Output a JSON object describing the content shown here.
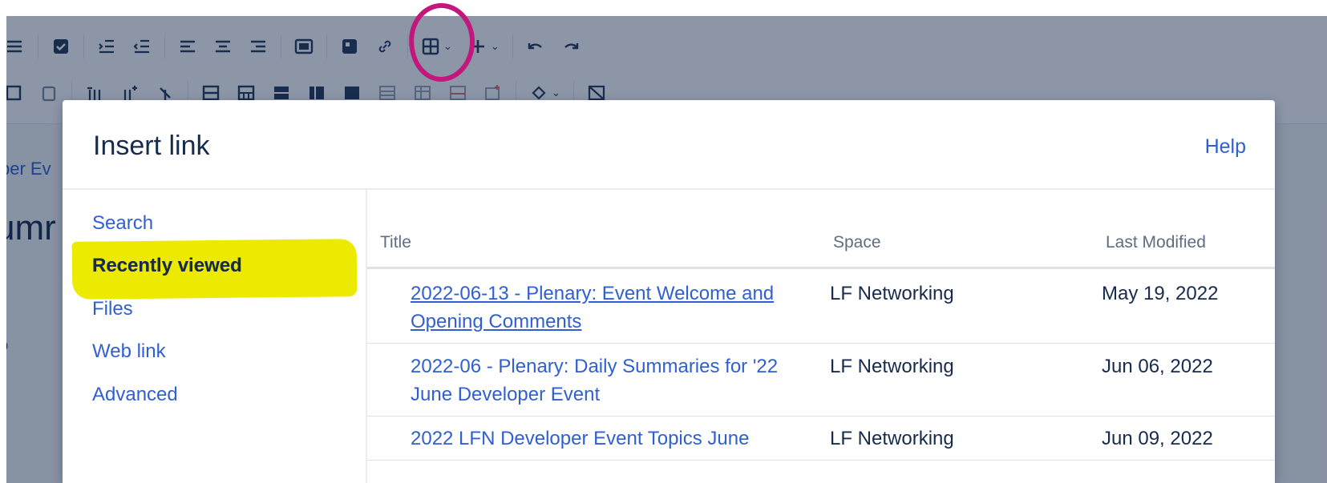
{
  "toolbar": {
    "row1_icons": [
      "bullet-list-icon",
      "task-checkbox-icon",
      "outdent-icon",
      "indent-icon",
      "align-left-icon",
      "align-center-icon",
      "align-right-icon",
      "layout-icon",
      "image-icon",
      "link-icon",
      "table-icon",
      "insert-more-icon",
      "undo-icon",
      "redo-icon"
    ],
    "row2_icons": [
      "merge-cells-icon",
      "paste-icon",
      "insert-column-before-icon",
      "insert-column-after-icon",
      "delete-column-icon",
      "table-header-row-icon",
      "table-numbered-icon",
      "table-header-column-icon",
      "table-row-icon",
      "table-cell-icon",
      "table-delete-icon",
      "table-insert-row-icon",
      "table-insert-col-icon",
      "table-copy-icon",
      "cell-color-icon",
      "table-remove-icon"
    ]
  },
  "background": {
    "breadcrumb_fragment": "per Ev",
    "title_fragment": "umr",
    "text_fragment": "o"
  },
  "dialog": {
    "title": "Insert link",
    "help": "Help",
    "nav": {
      "items": [
        {
          "label": "Search",
          "active": false
        },
        {
          "label": "Recently viewed",
          "active": true
        },
        {
          "label": "Files",
          "active": false
        },
        {
          "label": "Web link",
          "active": false
        },
        {
          "label": "Advanced",
          "active": false
        }
      ]
    },
    "table": {
      "headers": {
        "title": "Title",
        "space": "Space",
        "modified": "Last Modified"
      },
      "rows": [
        {
          "title_line1": "2022-06-13 - Plenary: Event Welcome and",
          "title_line2": "Opening Comments",
          "space": "LF Networking",
          "modified": "May 19, 2022"
        },
        {
          "title_line1": "2022-06 - Plenary: Daily Summaries for '22",
          "title_line2": "June Developer Event",
          "space": "LF Networking",
          "modified": "Jun 06, 2022"
        },
        {
          "title_line1": "2022 LFN Developer Event Topics June",
          "title_line2": "",
          "space": "LF Networking",
          "modified": "Jun 09, 2022"
        }
      ]
    }
  },
  "colors": {
    "link": "#2f5fd0",
    "text": "#172b4d",
    "highlight": "#ecea00",
    "annotation_circle": "#c2177c"
  }
}
